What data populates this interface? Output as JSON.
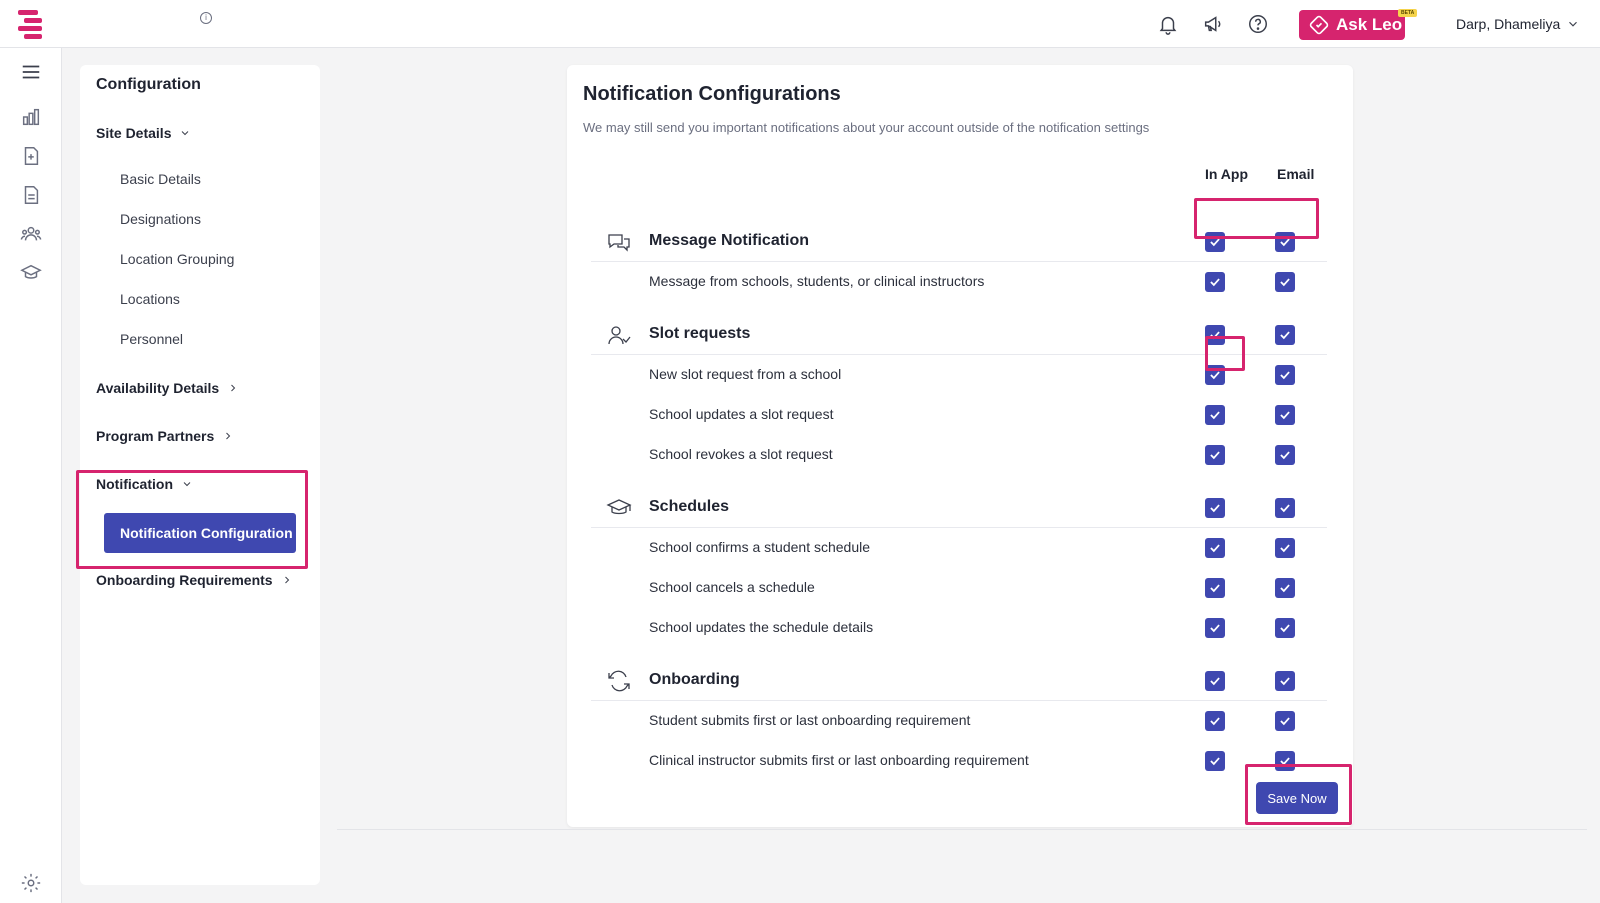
{
  "header": {
    "ask_leo_label": "Ask Leo",
    "beta_label": "BETA",
    "user_name": "Darp, Dhameliya",
    "colors": {
      "brand": "#d6246e",
      "primary": "#3f48b0"
    }
  },
  "rail": {
    "icons": [
      "menu-icon",
      "dashboard-chart-icon",
      "add-document-icon",
      "document-icon",
      "people-group-icon",
      "graduation-cap-icon",
      "settings-gear-icon"
    ]
  },
  "sidebar": {
    "title": "Configuration",
    "site_details": {
      "label": "Site Details",
      "items": [
        "Basic Details",
        "Designations",
        "Location Grouping",
        "Locations",
        "Personnel"
      ]
    },
    "availability_details": "Availability Details",
    "program_partners": "Program Partners",
    "notification": {
      "label": "Notification",
      "active_item": "Notification Configuration"
    },
    "onboarding_requirements": "Onboarding Requirements"
  },
  "main": {
    "title": "Notification Configurations",
    "subtitle": "We may still send you important notifications about your account outside of the notification settings",
    "columns": {
      "in_app": "In App",
      "email": "Email"
    },
    "groups": [
      {
        "label": "Message Notification",
        "icon": "chat-bubbles-icon",
        "in_app": true,
        "email": true,
        "items": [
          {
            "label": "Message from schools, students, or clinical instructors",
            "in_app": true,
            "email": true
          }
        ]
      },
      {
        "label": "Slot requests",
        "icon": "user-request-icon",
        "in_app": true,
        "email": true,
        "items": [
          {
            "label": "New slot request from a school",
            "in_app": true,
            "email": true
          },
          {
            "label": "School updates a slot request",
            "in_app": true,
            "email": true
          },
          {
            "label": "School revokes a slot request",
            "in_app": true,
            "email": true
          }
        ]
      },
      {
        "label": "Schedules",
        "icon": "graduation-cap-icon",
        "in_app": true,
        "email": true,
        "items": [
          {
            "label": "School confirms a student schedule",
            "in_app": true,
            "email": true
          },
          {
            "label": "School cancels a schedule",
            "in_app": true,
            "email": true
          },
          {
            "label": "School updates the schedule details",
            "in_app": true,
            "email": true
          }
        ]
      },
      {
        "label": "Onboarding",
        "icon": "refresh-cycle-icon",
        "in_app": true,
        "email": true,
        "items": [
          {
            "label": "Student submits first or last onboarding requirement",
            "in_app": true,
            "email": true
          },
          {
            "label": "Clinical instructor submits first or last onboarding requirement",
            "in_app": true,
            "email": true
          }
        ]
      }
    ],
    "save_label": "Save Now"
  }
}
